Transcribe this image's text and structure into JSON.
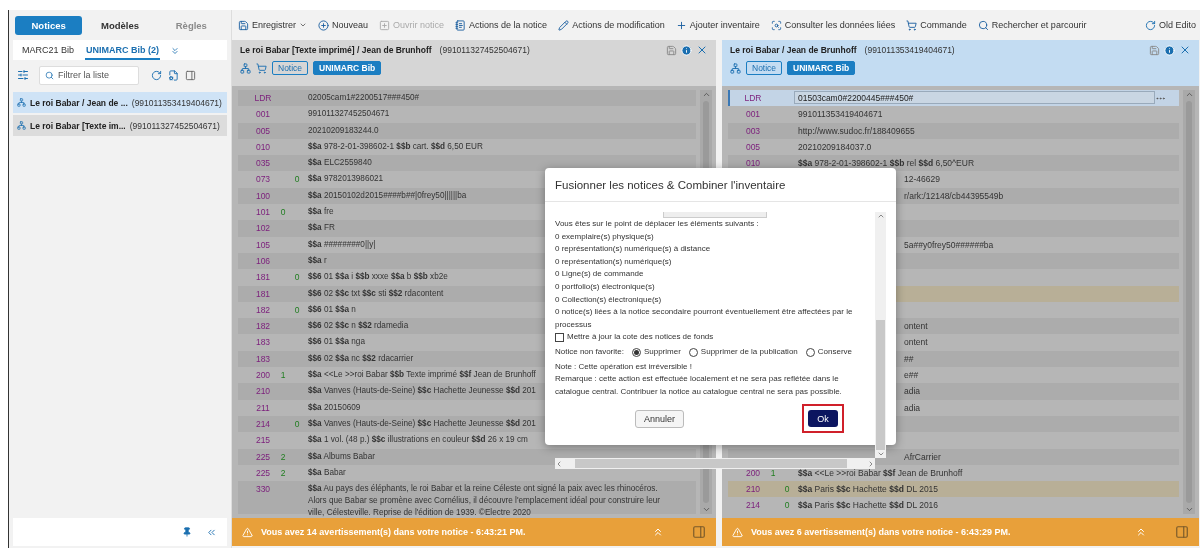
{
  "left_panel": {
    "tabs": [
      {
        "label": "Notices",
        "selected": true,
        "disabled": false
      },
      {
        "label": "Modèles",
        "selected": false,
        "disabled": false
      },
      {
        "label": "Règles",
        "selected": false,
        "disabled": true
      }
    ],
    "record_tabs": [
      {
        "label": "MARC21 Bib",
        "selected": false
      },
      {
        "label": "UNIMARC Bib (2)",
        "selected": true
      }
    ],
    "filter": {
      "placeholder": "Filtrer la liste"
    },
    "records": [
      {
        "title": "Le roi Babar / Jean de ...",
        "id": "(991011353419404671)",
        "selected": true
      },
      {
        "title": "Le roi Babar [Texte im...",
        "id": "(991011327452504671)",
        "selected": false
      }
    ]
  },
  "toolbar": [
    {
      "kind": "save",
      "label": "Enregistrer",
      "dropdown": true,
      "disabled": false
    },
    {
      "kind": "new",
      "label": "Nouveau",
      "dropdown": false,
      "disabled": false
    },
    {
      "kind": "open",
      "label": "Ouvrir notice",
      "dropdown": false,
      "disabled": true
    },
    {
      "kind": "actions",
      "label": "Actions de la notice",
      "dropdown": false,
      "disabled": false
    },
    {
      "kind": "edit",
      "label": "Actions de modification",
      "dropdown": false,
      "disabled": false
    },
    {
      "kind": "add",
      "label": "Ajouter inventaire",
      "dropdown": false,
      "disabled": false
    },
    {
      "kind": "linked",
      "label": "Consulter les données liées",
      "dropdown": false,
      "disabled": false
    },
    {
      "kind": "order",
      "label": "Commande",
      "dropdown": false,
      "disabled": false
    },
    {
      "kind": "search",
      "label": "Rechercher et parcourir",
      "dropdown": false,
      "disabled": false
    }
  ],
  "old_editor": {
    "label": "Old Edito"
  },
  "editors": [
    {
      "title": "Le roi Babar [Texte imprimé] / Jean de Brunhoff",
      "id": "(991011327452504671)",
      "active": false,
      "cart": true,
      "badges": [
        "Notice",
        "UNIMARC Bib"
      ],
      "fields": [
        {
          "kind": "field",
          "tag": "LDR",
          "value": "02005cam1#2200517###450#"
        },
        {
          "kind": "field",
          "tag": "001",
          "value": "991011327452504671"
        },
        {
          "kind": "field",
          "tag": "005",
          "value": "20210209183244.0"
        },
        {
          "kind": "field",
          "tag": "010",
          "value": "**$$a** 978-2-01-398602-1 **$$b** cart. **$$d** 6,50 EUR"
        },
        {
          "kind": "field",
          "tag": "035",
          "value": "**$$a** ELC2559840"
        },
        {
          "kind": "field",
          "tag": "073",
          "ind2": "0",
          "value": "**$$a** 9782013986021"
        },
        {
          "kind": "field",
          "tag": "100",
          "value": "**$$a** 20150102d2015####b##|0frey50||||||ba"
        },
        {
          "kind": "field",
          "tag": "101",
          "ind1": "0",
          "value": "**$$a** fre"
        },
        {
          "kind": "field",
          "tag": "102",
          "value": "**$$a** FR"
        },
        {
          "kind": "field",
          "tag": "105",
          "value": "**$$a** ########0||y|"
        },
        {
          "kind": "field",
          "tag": "106",
          "value": "**$$a** r"
        },
        {
          "kind": "field",
          "tag": "181",
          "ind2": "0",
          "value": "**$$6** 01 **$$a** i **$$b** xxxe **$$a** b **$$b** xb2e"
        },
        {
          "kind": "field",
          "tag": "181",
          "value": "**$$6** 02 **$$c** txt **$$c** sti **$$2** rdacontent"
        },
        {
          "kind": "field",
          "tag": "182",
          "ind2": "0",
          "value": "**$$6** 01 **$$a** n"
        },
        {
          "kind": "field",
          "tag": "182",
          "value": "**$$6** 02 **$$c** n **$$2** rdamedia"
        },
        {
          "kind": "field",
          "tag": "183",
          "value": "**$$6** 01 **$$a** nga"
        },
        {
          "kind": "field",
          "tag": "183",
          "value": "**$$6** 02 **$$a** nc **$$2** rdacarrier"
        },
        {
          "kind": "field",
          "tag": "200",
          "ind1": "1",
          "value": "**$$a** <<Le >>roi Babar **$$b** Texte imprimé **$$f** Jean de Brunhoff"
        },
        {
          "kind": "field",
          "tag": "210",
          "value": "**$$a** Vanves (Hauts-de-Seine) **$$c** Hachette Jeunesse **$$d** 201"
        },
        {
          "kind": "field",
          "tag": "211",
          "value": "**$$a** 20150609"
        },
        {
          "kind": "field",
          "tag": "214",
          "ind2": "0",
          "value": "**$$a** Vanves (Hauts-de-Seine) **$$c** Hachette Jeunesse **$$d** 201"
        },
        {
          "kind": "field",
          "tag": "215",
          "value": "**$$a** 1 vol. (48 p.) **$$c** illustrations en couleur **$$d** 26 x 19 cm"
        },
        {
          "kind": "field",
          "tag": "225",
          "ind1": "2",
          "value": "**$$a** Albums Babar"
        },
        {
          "kind": "field",
          "tag": "225",
          "ind1": "2",
          "value": "**$$a** Babar"
        },
        {
          "kind": "field",
          "tag": "330",
          "value": "**$$a** Au pays des éléphants, le roi Babar et la reine Céleste ont signé la paix avec les rhinocéros. Alors que Babar se promène avec Cornélius, il découvre l'emplacement idéal pour construire leur ville, Célesteville. Reprise de l'édition de 1939. ©Electre 2020"
        }
      ],
      "warning": "Vous avez 14 avertissement(s) dans votre notice - 6:43:21 PM."
    },
    {
      "title": "Le roi Babar / Jean de Brunhoff",
      "id": "(991011353419404671)",
      "active": true,
      "cart": false,
      "badges": [
        "Notice",
        "UNIMARC Bib"
      ],
      "fields": [
        {
          "kind": "editing",
          "tag": "LDR",
          "value": "01503cam0#2200445###450#",
          "highlighted": false
        },
        {
          "kind": "field",
          "tag": "001",
          "value": "991011353419404671",
          "highlighted": false
        },
        {
          "kind": "field",
          "tag": "003",
          "value": "http://www.sudoc.fr/188409655",
          "highlighted": false
        },
        {
          "kind": "field",
          "tag": "005",
          "value": "20210209184037.0",
          "highlighted": false
        },
        {
          "kind": "field",
          "tag": "010",
          "value": "**$$a** 978-2-01-398602-1 **$$b** rel **$$d** 6,50^EUR",
          "highlighted": false
        },
        {
          "kind": "partial",
          "value": "12-46629",
          "highlighted": false
        },
        {
          "kind": "partial",
          "value": "r/ark:/12148/cb44395549b",
          "highlighted": false
        },
        {
          "kind": "partial",
          "highlighted": false
        },
        {
          "kind": "partial",
          "highlighted": false
        },
        {
          "kind": "partial",
          "value": "5a##y0frey50######ba",
          "highlighted": false
        },
        {
          "kind": "partial",
          "highlighted": false
        },
        {
          "kind": "partial",
          "highlighted": false
        },
        {
          "kind": "partial",
          "highlighted": true
        },
        {
          "kind": "partial",
          "highlighted": false
        },
        {
          "kind": "partial",
          "value": "ontent",
          "highlighted": false
        },
        {
          "kind": "partial",
          "value": "ontent",
          "highlighted": false
        },
        {
          "kind": "partial",
          "value": "##",
          "highlighted": false
        },
        {
          "kind": "partial",
          "value": "e##",
          "highlighted": false
        },
        {
          "kind": "partial",
          "value": "adia",
          "highlighted": false
        },
        {
          "kind": "partial",
          "value": "adia",
          "highlighted": false
        },
        {
          "kind": "partial",
          "highlighted": false
        },
        {
          "kind": "partial",
          "highlighted": false
        },
        {
          "kind": "partial",
          "value": "AfrCarrier",
          "highlighted": false
        },
        {
          "kind": "field",
          "tag": "200",
          "ind1": "1",
          "value": "**$$a** <<Le >>roi Babar **$$f** Jean de Brunhoff",
          "highlighted": false
        },
        {
          "kind": "field",
          "tag": "210",
          "ind2": "0",
          "value": "**$$a** Paris **$$c** Hachette **$$d** DL 2015",
          "highlighted": true
        },
        {
          "kind": "field",
          "tag": "214",
          "ind2": "0",
          "value": "**$$a** Paris **$$c** Hachette **$$d** DL 2016",
          "highlighted": false
        }
      ],
      "warning": "Vous avez 6 avertissement(s) dans votre notice - 6:43:29 PM."
    }
  ],
  "dialog": {
    "title": "Fusionner les notices & Combiner l'inventaire",
    "intro": "Vous êtes sur le point de déplacer les éléments suivants :",
    "items": [
      "0 exemplaire(s) physique(s)",
      "0 représentation(s) numérique(s) à distance",
      "0 représentation(s) numérique(s)",
      "0 Ligne(s) de commande",
      "0 portfolio(s) électronique(s)",
      "0 Collection(s) électronique(s)",
      "0 notice(s) liées à la notice secondaire pourront éventuellement être affectées par le processus"
    ],
    "checkbox": {
      "label": "Mettre à jour la cote des notices de fonds",
      "checked": false
    },
    "radio_label": "Notice non favorite:",
    "radios": [
      {
        "label": "Supprimer",
        "selected": true
      },
      {
        "label": "Supprimer de la publication",
        "selected": false
      },
      {
        "label": "Conserve",
        "selected": false
      }
    ],
    "note": "Note : Cette opération est irréversible !",
    "remark": "Remarque : cette action est effectuée localement et ne sera pas reflétée dans le catalogue central. Contribuer la notice au catalogue central ne sera pas possible.",
    "cancel": "Annuler",
    "ok": "Ok",
    "ok_highlighted": true
  }
}
